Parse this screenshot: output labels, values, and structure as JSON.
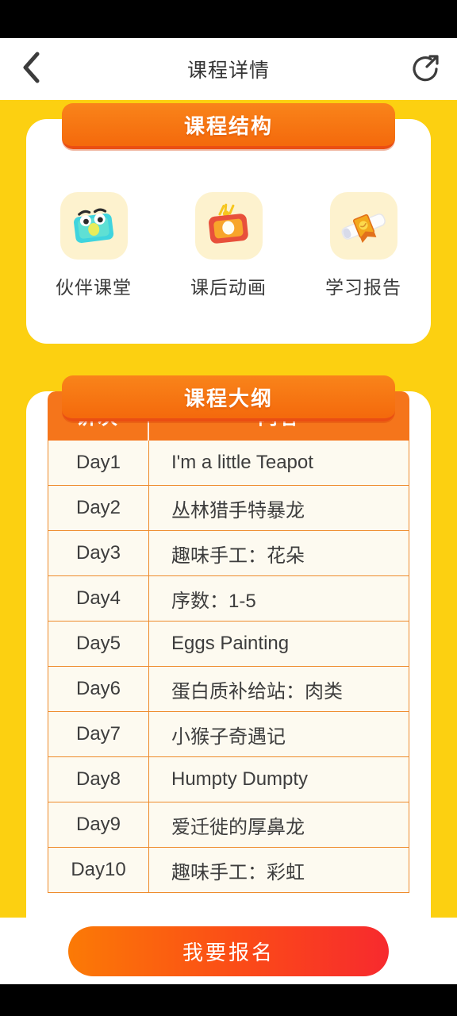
{
  "header": {
    "title": "课程详情",
    "back_icon": "chevron-left-icon",
    "share_icon": "share-circle-icon"
  },
  "theme": {
    "page_background": "#FCD011",
    "card_background": "#FFFFFF",
    "tab_orange": "#F5751B",
    "tab_orange_dark": "#EA4E13",
    "table_row_background": "#FDFAF0",
    "table_border": "#EE8B2B",
    "cta_gradient_start": "#FB7A06",
    "cta_gradient_end": "#F72A2E",
    "icon_tile_background": "#FDF2CE"
  },
  "structure_card": {
    "tab_label": "课程结构",
    "items": [
      {
        "label": "伙伴课堂",
        "icon": "tablet-face-icon"
      },
      {
        "label": "课后动画",
        "icon": "television-icon"
      },
      {
        "label": "学习报告",
        "icon": "diploma-scroll-icon"
      }
    ]
  },
  "outline_card": {
    "tab_label": "课程大纲",
    "columns": [
      "讲次",
      "内容"
    ],
    "rows": [
      {
        "lesson": "Day1",
        "content": "I'm a little Teapot"
      },
      {
        "lesson": "Day2",
        "content": "丛林猎手特暴龙"
      },
      {
        "lesson": "Day3",
        "content": "趣味手工：花朵"
      },
      {
        "lesson": "Day4",
        "content": "序数：1-5"
      },
      {
        "lesson": "Day5",
        "content": "Eggs Painting"
      },
      {
        "lesson": "Day6",
        "content": "蛋白质补给站：肉类"
      },
      {
        "lesson": "Day7",
        "content": "小猴子奇遇记"
      },
      {
        "lesson": "Day8",
        "content": "Humpty Dumpty"
      },
      {
        "lesson": "Day9",
        "content": "爱迁徙的厚鼻龙"
      },
      {
        "lesson": "Day10",
        "content": "趣味手工：彩虹"
      }
    ]
  },
  "bottom": {
    "cta_label": "我要报名"
  }
}
